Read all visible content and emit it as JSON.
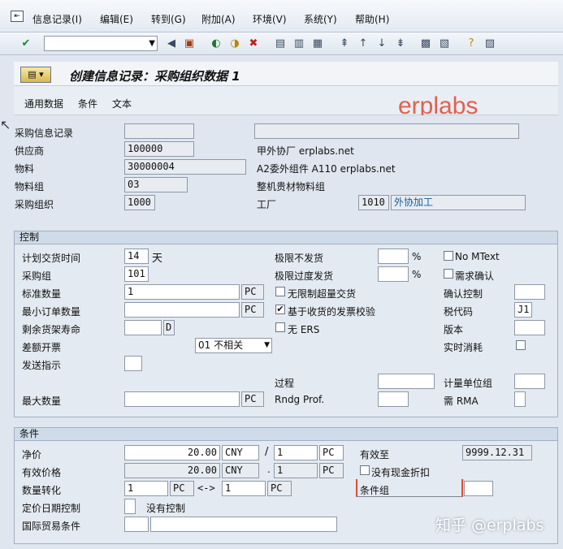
{
  "menu": {
    "items": [
      "信息记录(I)",
      "编辑(E)",
      "转到(G)",
      "附加(A)",
      "环境(V)",
      "系统(Y)",
      "帮助(H)"
    ]
  },
  "toolbar": {
    "command_value": ""
  },
  "title": "创建信息记录：采购组织数据 1",
  "app_tabs": [
    "通用数据",
    "条件",
    "文本"
  ],
  "watermark": "erplabs",
  "footer_watermark": "知乎 @erplabs",
  "header": {
    "info_record_label": "采购信息记录",
    "info_record_value": "",
    "info_record_desc": "",
    "vendor_label": "供应商",
    "vendor_value": "100000",
    "vendor_desc": "甲外协厂 erplabs.net",
    "material_label": "物料",
    "material_value": "30000004",
    "material_desc": "A2委外组件 A110 erplabs.net",
    "matgroup_label": "物料组",
    "matgroup_value": "03",
    "matgroup_desc": "整机贵材物料组",
    "purch_org_label": "采购组织",
    "purch_org_value": "1000",
    "plant_label": "工厂",
    "plant_value": "1010",
    "plant_desc": "外协加工"
  },
  "control": {
    "title": "控制",
    "plan_time_label": "计划交货时间",
    "plan_time_value": "14",
    "plan_time_unit": "天",
    "purch_group_label": "采购组",
    "purch_group_value": "101",
    "std_qty_label": "标准数量",
    "std_qty_value": "1",
    "std_qty_unit": "PC",
    "min_qty_label": "最小订单数量",
    "min_qty_value": "",
    "min_qty_unit": "PC",
    "shelf_life_label": "剩余货架寿命",
    "shelf_life_value": "",
    "shelf_life_unit": "D",
    "diff_invoice_label": "差额开票",
    "diff_invoice_value": "01 不相关",
    "ship_instr_label": "发送指示",
    "ship_instr_value": "",
    "max_qty_label": "最大数量",
    "max_qty_value": "",
    "max_qty_unit": "PC",
    "under_tol_label": "极限不发货",
    "under_tol_value": "",
    "over_tol_label": "极限过度发货",
    "over_tol_value": "",
    "percent": "%",
    "unlimited_label": "无限制超量交货",
    "unlimited_checked": false,
    "gr_iv_label": "基于收货的发票校验",
    "gr_iv_checked": true,
    "no_ers_label": "无 ERS",
    "no_ers_checked": false,
    "process_label": "过程",
    "process_value": "",
    "rndg_label": "Rndg Prof.",
    "rndg_value": "",
    "no_mtext_label": "No MText",
    "no_mtext_checked": false,
    "ack_req_label": "需求确认",
    "ack_req_checked": false,
    "conf_ctrl_label": "确认控制",
    "conf_ctrl_value": "",
    "tax_code_label": "税代码",
    "tax_code_value": "J1",
    "version_label": "版本",
    "version_value": "",
    "rt_consume_label": "实时消耗",
    "rt_consume_checked": false,
    "uom_group_label": "计量单位组",
    "uom_group_value": "",
    "rma_label": "需 RMA",
    "rma_value": ""
  },
  "conditions": {
    "title": "条件",
    "net_price_label": "净价",
    "net_price_value": "20.00",
    "net_price_curr": "CNY",
    "per_sep": "/",
    "per_value": "1",
    "per_unit": "PC",
    "eff_price_label": "有效价格",
    "eff_price_value": "20.00",
    "eff_price_curr": "CNY",
    "eff_sep": ".",
    "eff_per_value": "1",
    "eff_per_unit": "PC",
    "qty_conv_label": "数量转化",
    "qty_conv_left": "1",
    "qty_conv_left_unit": "PC",
    "qty_conv_arrow": "<->",
    "qty_conv_right": "1",
    "qty_conv_right_unit": "PC",
    "pricing_date_label": "定价日期控制",
    "pricing_date_value": "",
    "pricing_date_desc": "没有控制",
    "incoterms_label": "国际贸易条件",
    "incoterms_value1": "",
    "incoterms_value2": "",
    "valid_to_label": "有效至",
    "valid_to_value": "9999.12.31",
    "no_cash_label": "没有现金折扣",
    "no_cash_checked": false,
    "cond_group_label": "条件组",
    "cond_group_value": ""
  }
}
